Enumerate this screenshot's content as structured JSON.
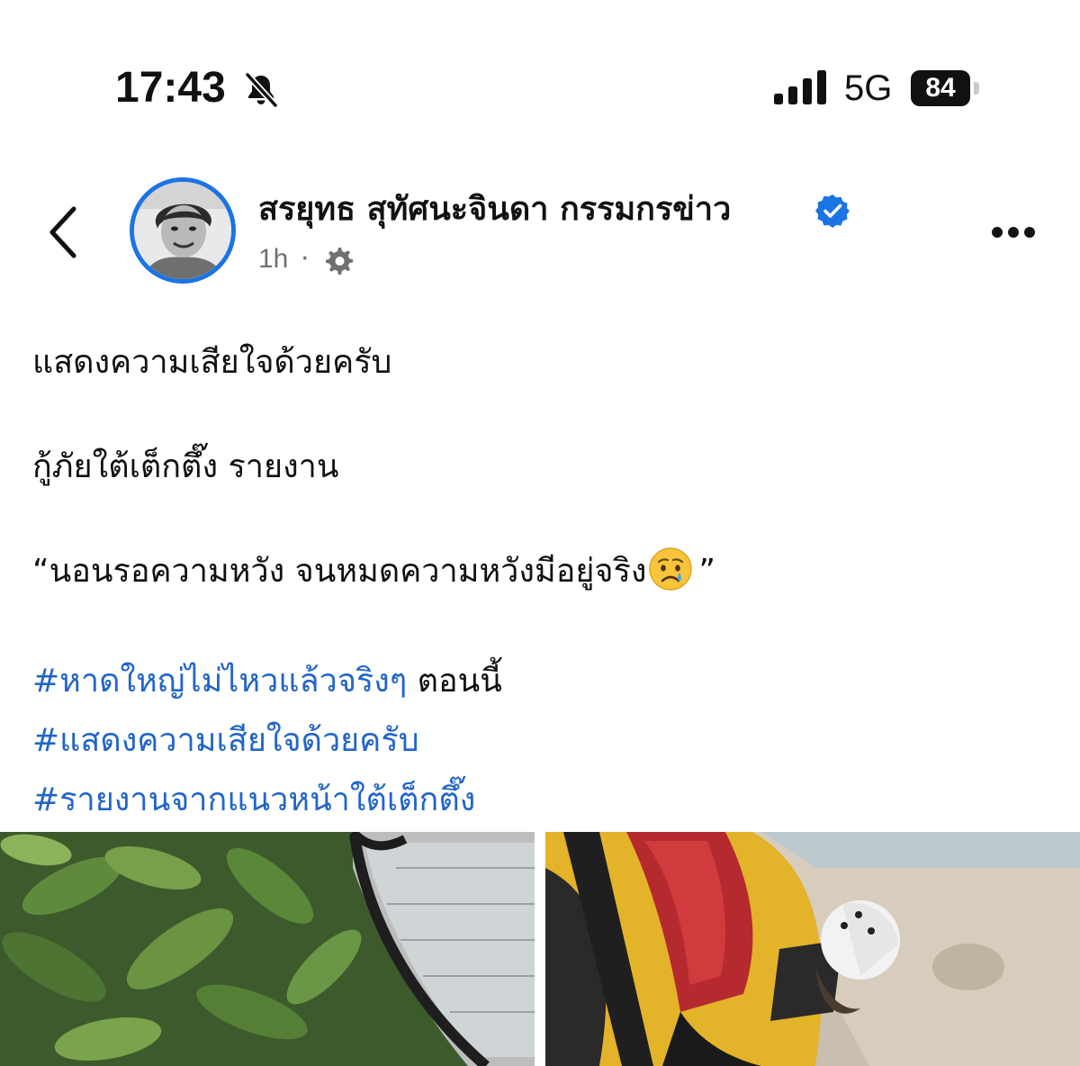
{
  "status_bar": {
    "time": "17:43",
    "network": "5G",
    "battery": "84",
    "icons": [
      "bell-off-icon",
      "signal-icon",
      "battery-icon"
    ]
  },
  "header": {
    "author_name": "สรยุทธ สุทัศนะจินดา กรรมกรข่าว",
    "time_ago": "1h",
    "separator": "·",
    "icons": [
      "back-icon",
      "verified-icon",
      "audience-icon",
      "more-icon"
    ]
  },
  "post": {
    "paragraphs": [
      "แสดงความเสียใจด้วยครับ",
      "กู้ภัยใต้เต็กตึ๊ง รายงาน"
    ],
    "quote_text": "“นอนรอความหวัง จนหมดความหวังมีอยู่จริง",
    "quote_close": "”",
    "hashtag_lines": [
      {
        "tag": "#หาดใหญ่ไม่ไหวแล้วจริงๆ",
        "suffix": " ตอนนี้"
      },
      {
        "tag": "#แสดงความเสียใจด้วยครับ",
        "suffix": ""
      },
      {
        "tag": "#รายงานจากแนวหน้าใต้เต็กตึ๊ง",
        "suffix": ""
      }
    ]
  },
  "photos": [
    "photo-foliage-umbrella",
    "photo-rescue-worker"
  ],
  "colors": {
    "hashtag": "#2265c9",
    "verified": "#1b74e4",
    "meta_text": "#707070"
  }
}
